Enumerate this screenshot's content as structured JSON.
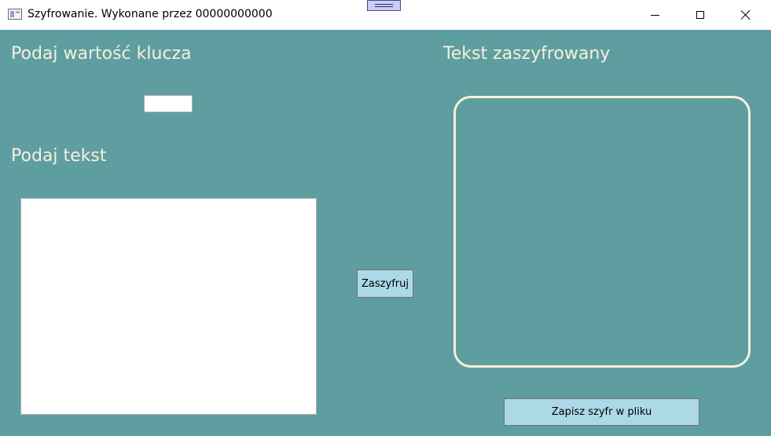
{
  "window": {
    "title": "Szyfrowanie. Wykonane przez 00000000000",
    "icon": "app-window-icon",
    "controls": [
      "minimize-icon",
      "maximize-icon",
      "close-icon"
    ]
  },
  "colors": {
    "background": "#5f9ea0",
    "heading_text": "#f5f0dc",
    "button_bg": "#add8e6",
    "cipher_border": "#f5f0dc"
  },
  "key_section": {
    "label": "Podaj wartość klucza",
    "value": ""
  },
  "text_section": {
    "label": "Podaj tekst",
    "value": ""
  },
  "cipher_section": {
    "label": "Tekst zaszyfrowany",
    "value": ""
  },
  "buttons": {
    "encrypt": "Zaszyfruj",
    "save": "Zapisz szyfr w pliku"
  }
}
